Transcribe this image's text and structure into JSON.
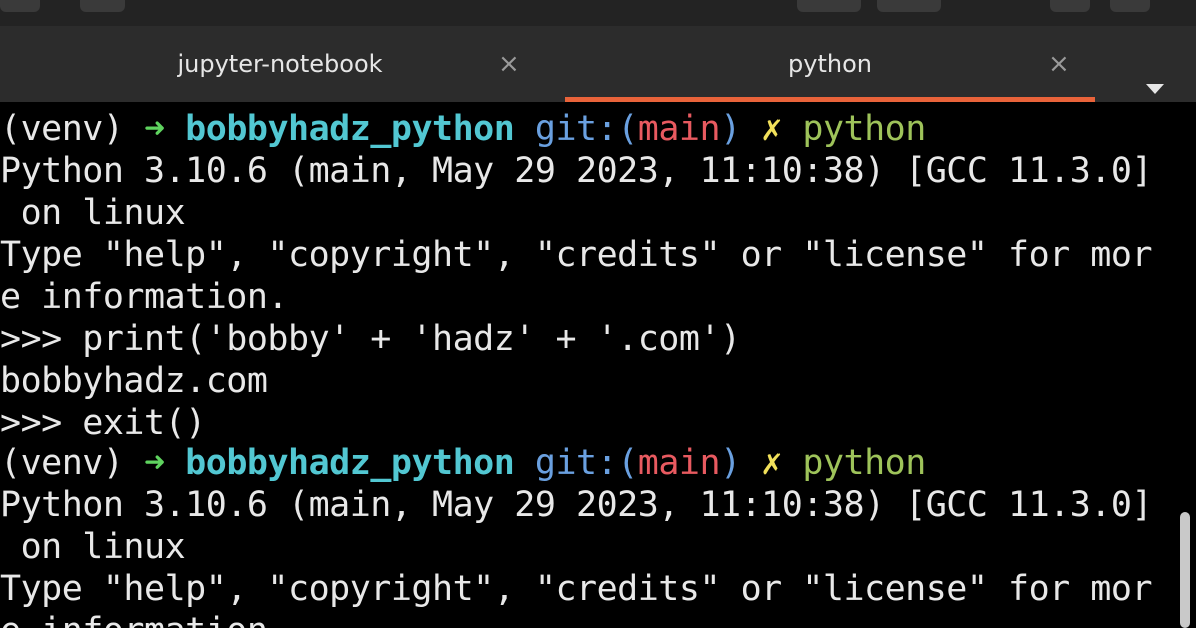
{
  "tabs": [
    {
      "label": "jupyter-notebook",
      "active": false
    },
    {
      "label": "python",
      "active": true
    }
  ],
  "tab_close_glyph": "×",
  "colors": {
    "accent_underline": "#e9633a",
    "prompt_arrow": "#5fd35f",
    "prompt_dir": "#52c7d2",
    "git_label": "#6aa0e0",
    "branch": "#e85a60",
    "dirty_mark": "#f1e05a",
    "command": "#9ec35a"
  },
  "terminal": {
    "prompt": {
      "venv": "(venv) ",
      "arrow": "➜",
      "dir": "bobbyhadz_python",
      "git_open": "git:(",
      "branch": "main",
      "git_close": ")",
      "dirty": "✗",
      "command": "python"
    },
    "lines": [
      "Python 3.10.6 (main, May 29 2023, 11:10:38) [GCC 11.3.0]",
      " on linux",
      "Type \"help\", \"copyright\", \"credits\" or \"license\" for mor",
      "e information.",
      ">>> print('bobby' + 'hadz' + '.com')",
      "bobbyhadz.com",
      ">>> exit()",
      "Python 3.10.6 (main, May 29 2023, 11:10:38) [GCC 11.3.0]",
      " on linux",
      "Type \"help\", \"copyright\", \"credits\" or \"license\" for mor",
      "e information."
    ]
  }
}
